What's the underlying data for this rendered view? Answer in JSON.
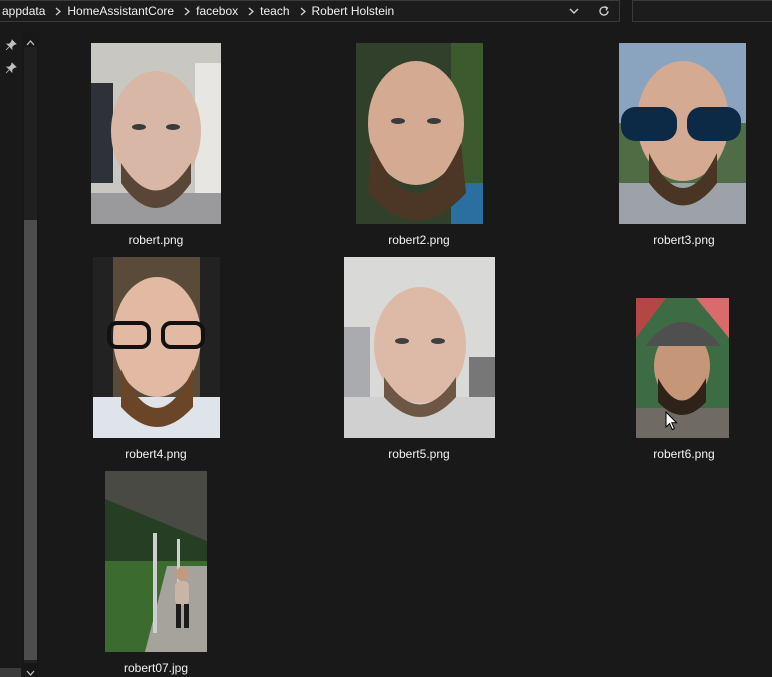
{
  "breadcrumb": [
    "appdata",
    "HomeAssistantCore",
    "facebox",
    "teach",
    "Robert Holstein"
  ],
  "files": [
    {
      "name": "robert.png"
    },
    {
      "name": "robert2.png"
    },
    {
      "name": "robert3.png"
    },
    {
      "name": "robert4.png"
    },
    {
      "name": "robert5.png"
    },
    {
      "name": "robert6.png"
    },
    {
      "name": "robert07.jpg"
    }
  ],
  "icons": {
    "breadcrumb_separator": "chevron-right-icon",
    "address_dropdown": "chevron-down-icon",
    "refresh": "refresh-icon",
    "pin": "pin-icon"
  }
}
